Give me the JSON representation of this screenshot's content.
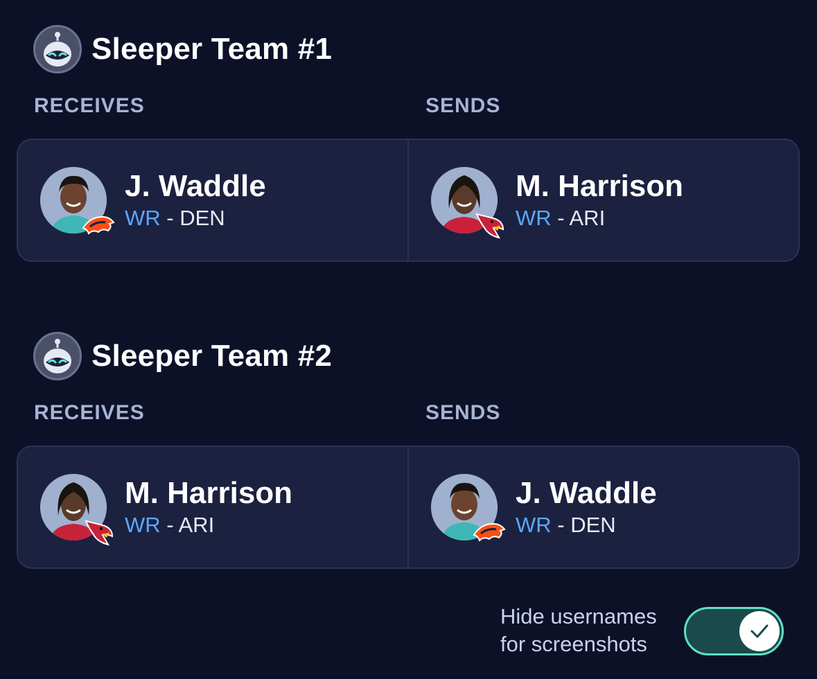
{
  "teams": [
    {
      "name": "Sleeper Team #1",
      "receives_label": "RECEIVES",
      "sends_label": "SENDS",
      "receives": {
        "name": "J. Waddle",
        "position": "WR",
        "separator": " - ",
        "team": "DEN",
        "logo": "broncos-logo-icon"
      },
      "sends": {
        "name": "M. Harrison",
        "position": "WR",
        "separator": " - ",
        "team": "ARI",
        "logo": "cardinals-logo-icon"
      }
    },
    {
      "name": "Sleeper Team #2",
      "receives_label": "RECEIVES",
      "sends_label": "SENDS",
      "receives": {
        "name": "M. Harrison",
        "position": "WR",
        "separator": " - ",
        "team": "ARI",
        "logo": "cardinals-logo-icon"
      },
      "sends": {
        "name": "J. Waddle",
        "position": "WR",
        "separator": " - ",
        "team": "DEN",
        "logo": "broncos-logo-icon"
      }
    }
  ],
  "toggle": {
    "label_line1": "Hide usernames",
    "label_line2": "for screenshots",
    "checked": true
  },
  "colors": {
    "background": "#0d1128",
    "card": "#1c2140",
    "position_accent": "#5aa8ff",
    "toggle_accent": "#5fe1c2"
  }
}
